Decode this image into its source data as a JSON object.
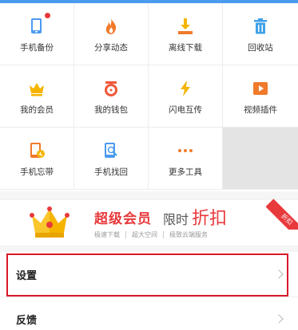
{
  "tools": [
    {
      "label": "手机备份",
      "icon": "phone-backup-icon"
    },
    {
      "label": "分享动态",
      "icon": "flame-icon"
    },
    {
      "label": "离线下载",
      "icon": "download-icon"
    },
    {
      "label": "回收站",
      "icon": "trash-icon"
    },
    {
      "label": "我的会员",
      "icon": "crown-icon"
    },
    {
      "label": "我的钱包",
      "icon": "wallet-icon"
    },
    {
      "label": "闪电互传",
      "icon": "lightning-icon"
    },
    {
      "label": "视频插件",
      "icon": "video-play-icon"
    },
    {
      "label": "手机忘带",
      "icon": "phone-forgot-icon"
    },
    {
      "label": "手机找回",
      "icon": "phone-find-icon"
    },
    {
      "label": "更多工具",
      "icon": "more-dots-icon"
    }
  ],
  "vip": {
    "title": "超级会员",
    "limit": "限时",
    "discount": "折扣",
    "features": [
      "极速下载",
      "超大空间",
      "极致云端服务"
    ],
    "badge": "折扣"
  },
  "menu": {
    "settings": "设置",
    "feedback": "反馈"
  },
  "colors": {
    "accent_blue": "#4b9af0",
    "accent_red": "#e8393b",
    "orange": "#f07a2a",
    "yellow": "#f5b400",
    "highlight_red": "#d9192b"
  }
}
